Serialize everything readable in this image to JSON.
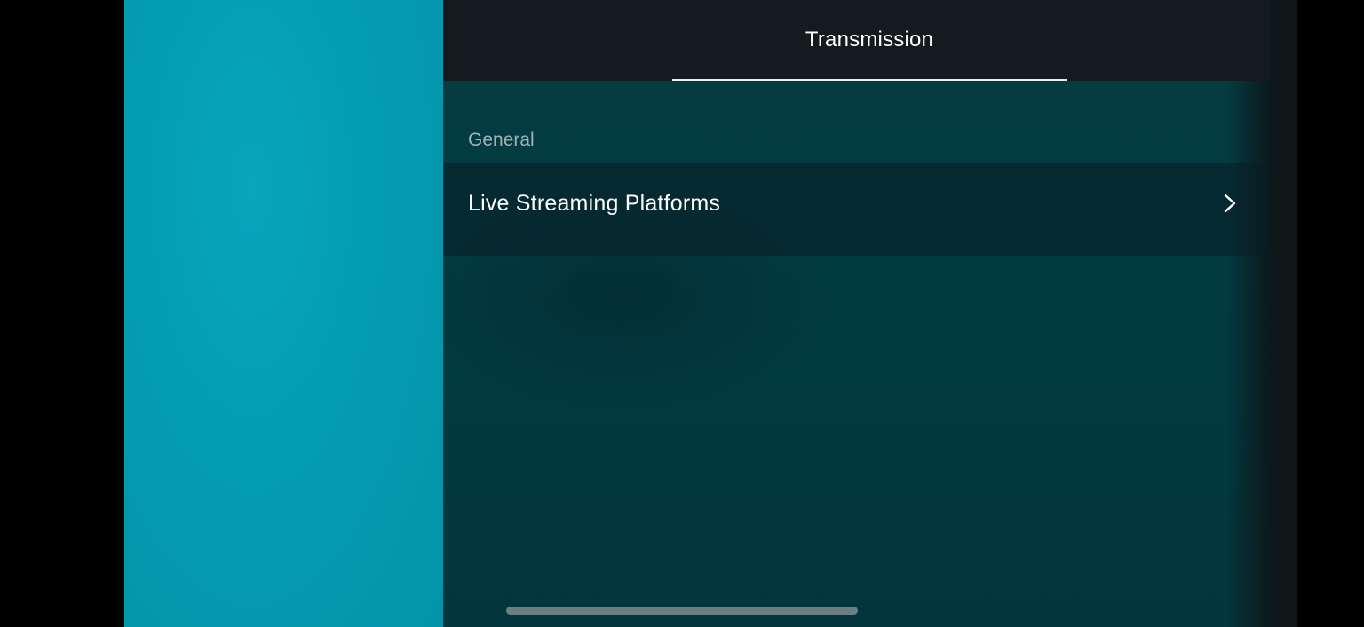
{
  "tabs": [
    {
      "label": "Transmission",
      "selected": true
    }
  ],
  "section": {
    "header": "General"
  },
  "rows": [
    {
      "label": "Live Streaming Platforms",
      "icon": "chevron-right-icon"
    }
  ],
  "colors": {
    "camera_preview": "#049cb2",
    "panel_background": "#033a41",
    "tab_bar": "#141a1d",
    "accent_underline": "#e8eef0"
  }
}
